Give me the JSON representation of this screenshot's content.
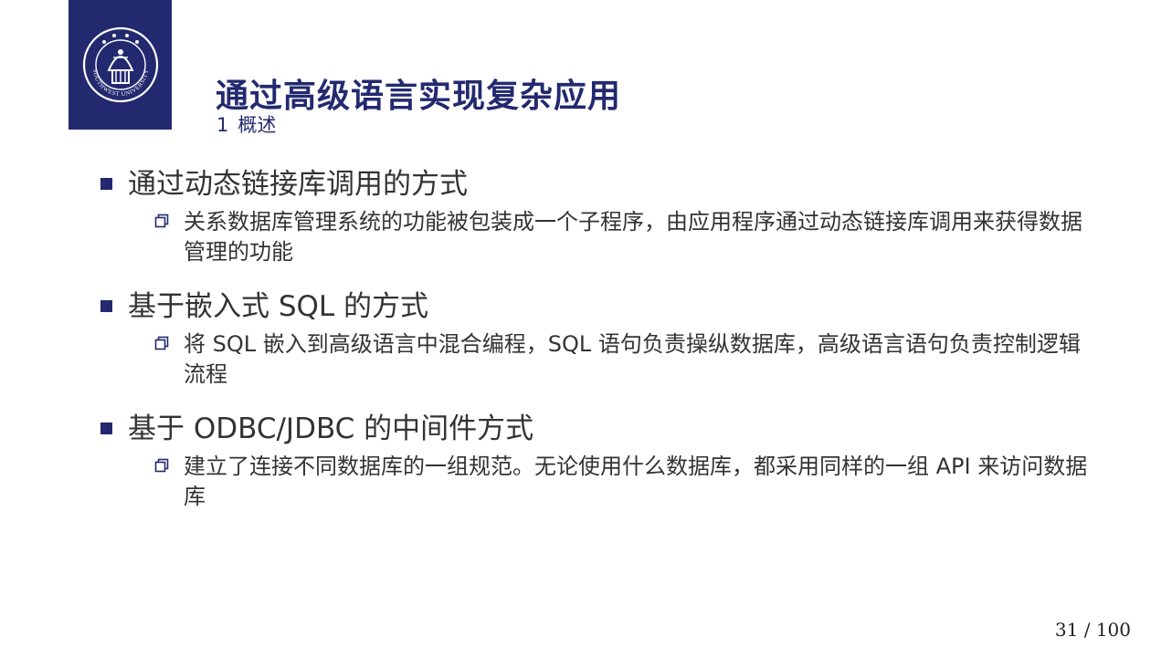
{
  "header": {
    "title": "通过高级语言实现复杂应用",
    "section_number": "1",
    "section_name": "概述"
  },
  "logo": {
    "name": "Southwest University seal",
    "text": "SOUTHWEST UNIVERSITY",
    "background": "#23296f"
  },
  "items": [
    {
      "heading": "通过动态链接库调用的方式",
      "detail": "关系数据库管理系统的功能被包装成一个子程序，由应用程序通过动态链接库调用来获得数据管理的功能"
    },
    {
      "heading": "基于嵌入式 SQL 的方式",
      "detail": "将 SQL 嵌入到高级语言中混合编程，SQL 语句负责操纵数据库，高级语言语句负责控制逻辑流程"
    },
    {
      "heading": "基于 ODBC/JDBC 的中间件方式",
      "detail": "建立了连接不同数据库的一组规范。无论使用什么数据库，都采用同样的一组 API 来访问数据库"
    }
  ],
  "footer": {
    "page": "31 / 100"
  },
  "colors": {
    "accent": "#23296f",
    "text": "#333333"
  }
}
